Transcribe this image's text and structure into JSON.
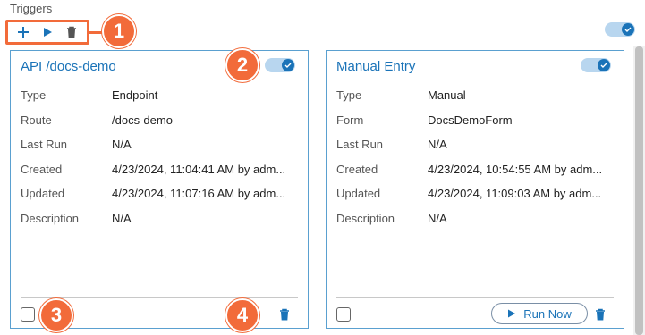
{
  "section": {
    "title": "Triggers"
  },
  "toolbar": {
    "add_icon": "plus-icon",
    "run_icon": "play-icon",
    "delete_icon": "trash-icon"
  },
  "callouts": [
    "1",
    "2",
    "3",
    "4"
  ],
  "global_toggle": {
    "on": true
  },
  "field_labels": [
    "Type",
    "Route",
    "Last Run",
    "Created",
    "Updated",
    "Description"
  ],
  "cards": [
    {
      "title": "API /docs-demo",
      "enabled": true,
      "fields": [
        {
          "label": "Type",
          "value": "Endpoint"
        },
        {
          "label": "Route",
          "value": "/docs-demo"
        },
        {
          "label": "Last Run",
          "value": "N/A"
        },
        {
          "label": "Created",
          "value": "4/23/2024, 11:04:41 AM by adm..."
        },
        {
          "label": "Updated",
          "value": "4/23/2024, 11:07:16 AM by adm..."
        },
        {
          "label": "Description",
          "value": "N/A"
        }
      ],
      "checked": false
    },
    {
      "title": "Manual Entry",
      "enabled": true,
      "fields": [
        {
          "label": "Type",
          "value": "Manual"
        },
        {
          "label": "Form",
          "value": "DocsDemoForm"
        },
        {
          "label": "Last Run",
          "value": "N/A"
        },
        {
          "label": "Created",
          "value": "4/23/2024, 10:54:55 AM by adm..."
        },
        {
          "label": "Updated",
          "value": "4/23/2024, 11:09:03 AM by adm..."
        },
        {
          "label": "Description",
          "value": "N/A"
        }
      ],
      "checked": false,
      "run_label": "Run Now"
    }
  ],
  "colors": {
    "accent": "#1a73b8",
    "callout": "#f26b3a",
    "card_border": "#5aa0d0"
  }
}
